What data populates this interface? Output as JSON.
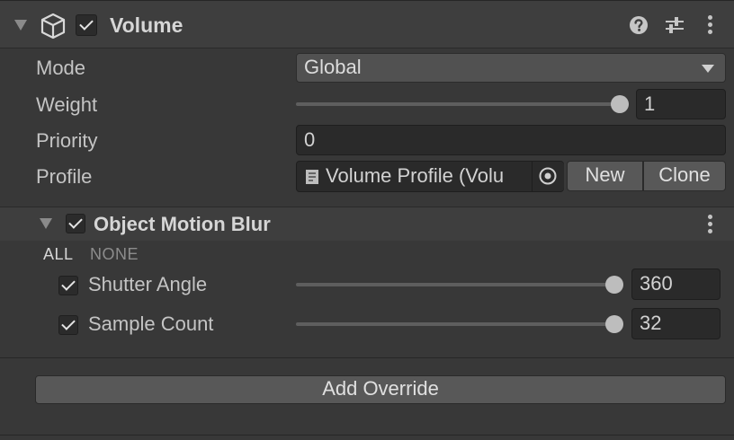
{
  "volume": {
    "title": "Volume",
    "enabled": true,
    "mode_label": "Mode",
    "mode_value": "Global",
    "weight_label": "Weight",
    "weight_value": "1",
    "weight_level": 1.0,
    "priority_label": "Priority",
    "priority_value": "0",
    "profile_label": "Profile",
    "profile_value": "Volume Profile (Volu",
    "new_label": "New",
    "clone_label": "Clone"
  },
  "override": {
    "title": "Object Motion Blur",
    "enabled": true,
    "all_label": "ALL",
    "none_label": "NONE",
    "params": [
      {
        "label": "Shutter Angle",
        "value": "360",
        "enabled": true,
        "level": 1.0
      },
      {
        "label": "Sample Count",
        "value": "32",
        "enabled": true,
        "level": 1.0
      }
    ]
  },
  "footer": {
    "add_override_label": "Add Override"
  },
  "icons": {
    "component": "cube-icon",
    "help": "help-icon",
    "presets": "sliders-icon",
    "menu": "kebab-menu-icon",
    "object_field": "scriptable-object-icon",
    "picker": "object-picker-icon"
  },
  "colors": {
    "background": "#383838",
    "header": "#3e3e3e",
    "field": "#2a2a2a",
    "button": "#585858"
  }
}
